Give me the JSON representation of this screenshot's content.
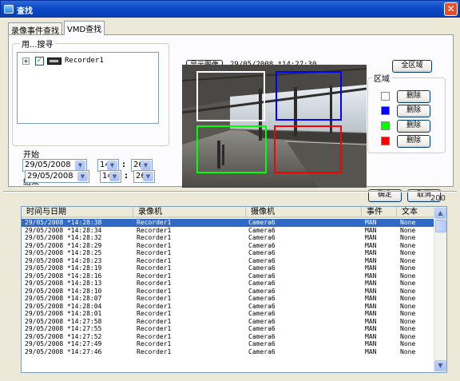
{
  "window": {
    "title": "查找"
  },
  "tabs": [
    {
      "label": "录像事件查找",
      "active": false
    },
    {
      "label": "VMD查找",
      "active": true
    }
  ],
  "search_group": {
    "label": "用...搜寻",
    "tree_item": "Recorder1",
    "checked": true
  },
  "start": {
    "label": "开始",
    "date": "29/05/2008",
    "hour": "14",
    "minute": "26"
  },
  "end": {
    "label": "结束",
    "date": "29/05/2008",
    "hour": "14",
    "minute": "26"
  },
  "time_separator": ":",
  "preview": {
    "show_image_label": "显示图像",
    "timestamp": "29/05/2008 *14:27:30",
    "all_area_label": "全区域"
  },
  "area_group": {
    "label": "区域",
    "zones": [
      {
        "color": "#ffffff",
        "delete_label": "删除"
      },
      {
        "color": "#0000ff",
        "delete_label": "删除"
      },
      {
        "color": "#00ff00",
        "delete_label": "删除"
      },
      {
        "color": "#ff0000",
        "delete_label": "删除"
      }
    ]
  },
  "actions": {
    "ok_label": "确定",
    "cancel_label": "取消"
  },
  "results": {
    "count": "200",
    "columns": [
      "时间与日期",
      "录像机",
      "摄像机",
      "事件",
      "文本"
    ],
    "rows": [
      [
        "29/05/2008 *14:28:38",
        "Recorder1",
        "Camera6",
        "MAN",
        "None"
      ],
      [
        "29/05/2008 *14:28:34",
        "Recorder1",
        "Camera6",
        "MAN",
        "None"
      ],
      [
        "29/05/2008 *14:28:32",
        "Recorder1",
        "Camera6",
        "MAN",
        "None"
      ],
      [
        "29/05/2008 *14:28:29",
        "Recorder1",
        "Camera6",
        "MAN",
        "None"
      ],
      [
        "29/05/2008 *14:28:25",
        "Recorder1",
        "Camera6",
        "MAN",
        "None"
      ],
      [
        "29/05/2008 *14:28:23",
        "Recorder1",
        "Camera6",
        "MAN",
        "None"
      ],
      [
        "29/05/2008 *14:28:19",
        "Recorder1",
        "Camera6",
        "MAN",
        "None"
      ],
      [
        "29/05/2008 *14:28:16",
        "Recorder1",
        "Camera6",
        "MAN",
        "None"
      ],
      [
        "29/05/2008 *14:28:13",
        "Recorder1",
        "Camera6",
        "MAN",
        "None"
      ],
      [
        "29/05/2008 *14:28:10",
        "Recorder1",
        "Camera6",
        "MAN",
        "None"
      ],
      [
        "29/05/2008 *14:28:07",
        "Recorder1",
        "Camera6",
        "MAN",
        "None"
      ],
      [
        "29/05/2008 *14:28:04",
        "Recorder1",
        "Camera6",
        "MAN",
        "None"
      ],
      [
        "29/05/2008 *14:28:01",
        "Recorder1",
        "Camera6",
        "MAN",
        "None"
      ],
      [
        "29/05/2008 *14:27:58",
        "Recorder1",
        "Camera6",
        "MAN",
        "None"
      ],
      [
        "29/05/2008 *14:27:55",
        "Recorder1",
        "Camera6",
        "MAN",
        "None"
      ],
      [
        "29/05/2008 *14:27:52",
        "Recorder1",
        "Camera6",
        "MAN",
        "None"
      ],
      [
        "29/05/2008 *14:27:49",
        "Recorder1",
        "Camera6",
        "MAN",
        "None"
      ],
      [
        "29/05/2008 *14:27:46",
        "Recorder1",
        "Camera6",
        "MAN",
        "None"
      ]
    ]
  }
}
